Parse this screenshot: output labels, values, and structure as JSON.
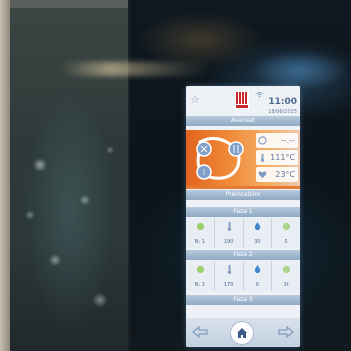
{
  "device": {
    "time": "11:00",
    "date": "18/06/2025",
    "mode_label": "Avansat",
    "temperatures": {
      "first": "--.--",
      "second": "111°C",
      "third": "23°C"
    },
    "preheat_label": "Preincalzire",
    "phases": [
      {
        "label": "Faza 1",
        "cells": [
          {
            "icon": "fan-icon",
            "value": "N: 1"
          },
          {
            "icon": "thermometer-icon",
            "value": "190"
          },
          {
            "icon": "water-drop-icon",
            "value": "30"
          },
          {
            "icon": "timer-icon",
            "value": "5"
          }
        ]
      },
      {
        "label": "Faza 2",
        "cells": [
          {
            "icon": "fan-icon",
            "value": "N: 2"
          },
          {
            "icon": "thermometer-icon",
            "value": "170"
          },
          {
            "icon": "water-drop-icon",
            "value": "0"
          },
          {
            "icon": "timer-icon",
            "value": "3t"
          }
        ]
      },
      {
        "label": "Faza 3",
        "cells": []
      }
    ],
    "nav": {
      "left_icon": "back-arrow-icon",
      "center_icon": "home-icon",
      "right_icon": "forward-arrow-icon"
    }
  },
  "colors": {
    "accent_orange": "#e47a33",
    "accent_blue": "#4e6a8f",
    "logo_red": "#c8282b"
  }
}
